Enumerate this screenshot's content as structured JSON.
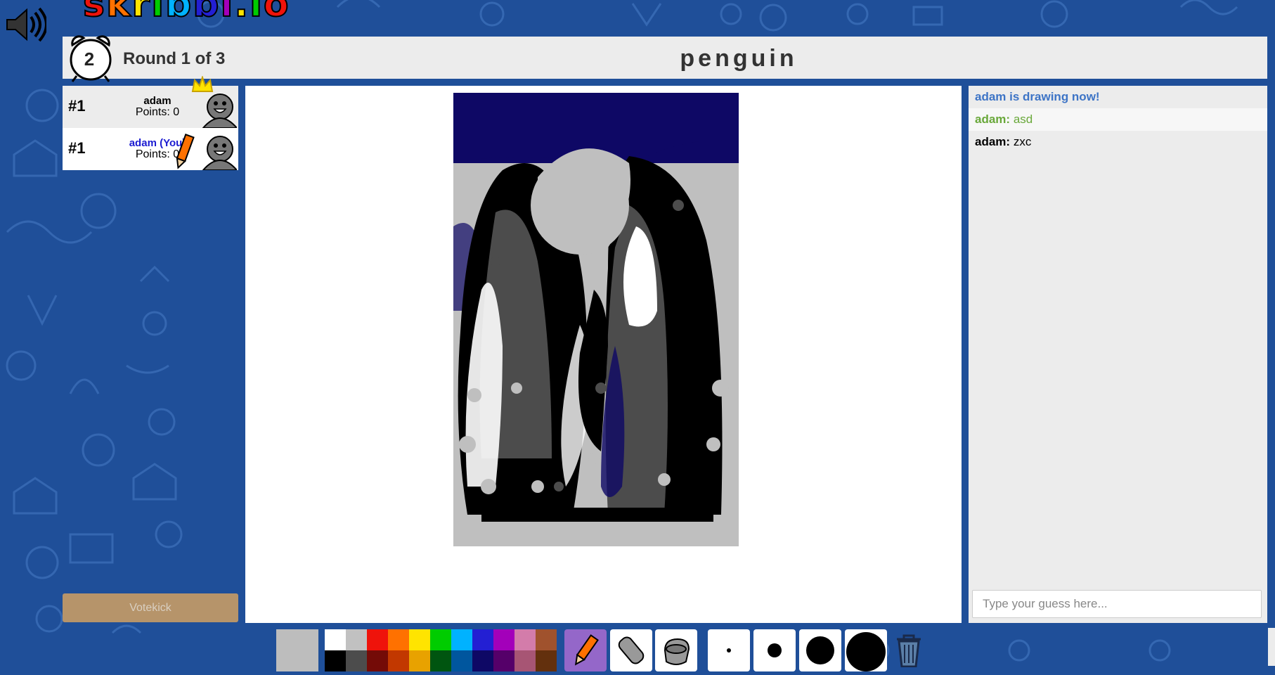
{
  "logo": {
    "text": "skribbl.io"
  },
  "header": {
    "timer": "2",
    "round": "Round 1 of 3",
    "word": "penguin"
  },
  "players": [
    {
      "rank": "#1",
      "name": "adam",
      "points": "Points: 0",
      "owner": true,
      "drawing": false,
      "you": false
    },
    {
      "rank": "#1",
      "name": "adam (You)",
      "points": "Points: 0",
      "owner": false,
      "drawing": true,
      "you": true
    }
  ],
  "votekick": "Votekick",
  "chat": {
    "messages": [
      {
        "type": "system",
        "text": "adam is drawing now!"
      },
      {
        "type": "guess",
        "name": "adam:",
        "text": "asd",
        "color": "#69a83a"
      },
      {
        "type": "guess",
        "name": "adam:",
        "text": "zxc",
        "color": "#000000"
      }
    ],
    "placeholder": "Type your guess here..."
  },
  "toolbar": {
    "current_color": "#bdbdbd",
    "palette_top": [
      "#ffffff",
      "#c1c1c1",
      "#ef130b",
      "#ff7100",
      "#ffe400",
      "#00cc00",
      "#00b2ff",
      "#231fd3",
      "#a300ba",
      "#d37caa",
      "#a0522d"
    ],
    "palette_bottom": [
      "#000000",
      "#4c4c4c",
      "#740b07",
      "#c23800",
      "#e8a200",
      "#005510",
      "#00569e",
      "#0e0865",
      "#550069",
      "#a75574",
      "#63300d"
    ],
    "tools": [
      "pencil-icon",
      "eraser-icon",
      "fill-icon"
    ],
    "brush_sizes": [
      4,
      14,
      34,
      48
    ]
  },
  "drawing_colors": {
    "navy": "#0e0865",
    "gray": "#bfbfbf",
    "dark": "#4c4c4c",
    "black": "#000000",
    "white": "#ffffff"
  }
}
